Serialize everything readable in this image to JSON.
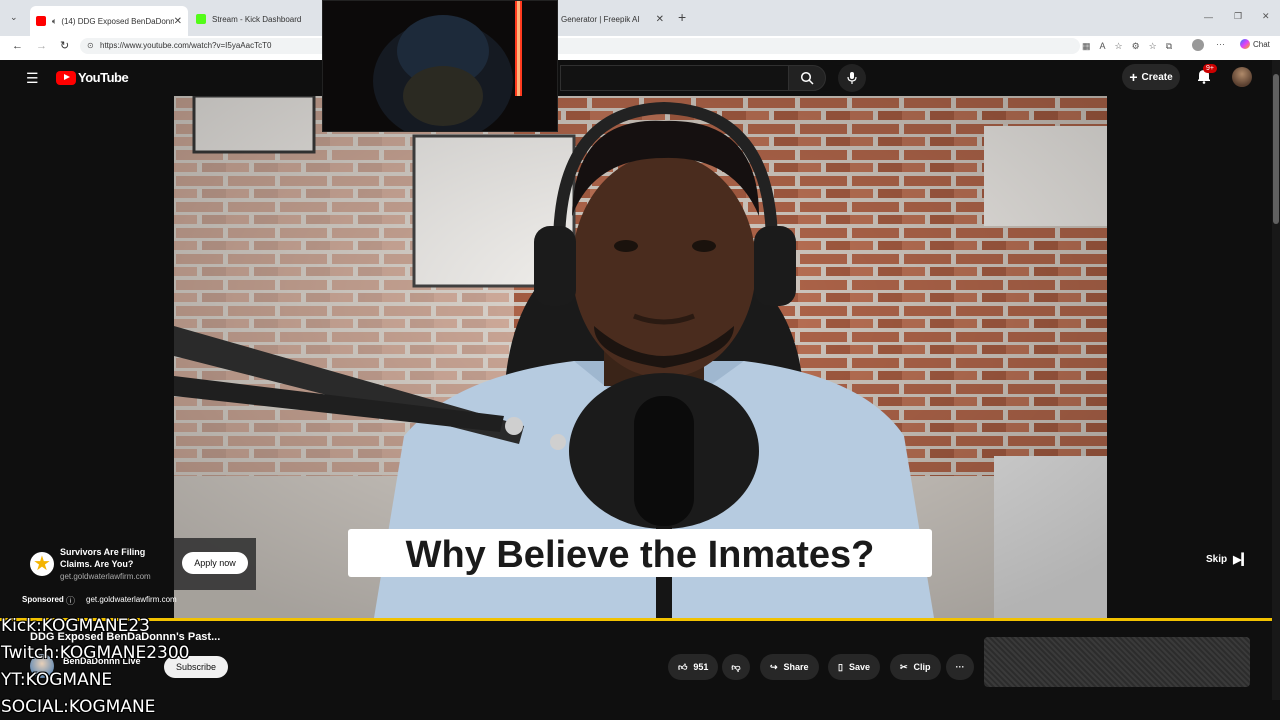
{
  "browser": {
    "tabs": [
      {
        "label": "(14) DDG Exposed BenDaDonn",
        "active": true
      },
      {
        "label": "Stream - Kick Dashboard",
        "active": false
      },
      {
        "label": "Generator | Freepik AI",
        "active": false
      }
    ],
    "new_tab": "+",
    "url": "https://www.youtube.com/watch?v=I5yaAacTcT0",
    "chat_label": "Chat"
  },
  "youtube": {
    "logo_text": "YouTube",
    "create_label": "Create",
    "notification_count": "9+"
  },
  "video": {
    "caption": "Why Believe the Inmates?",
    "skip_label": "Skip"
  },
  "ad": {
    "headline": "Survivors Are Filing Claims. Are You?",
    "domain": "get.goldwaterlawfirm.com",
    "cta": "Apply now",
    "sponsored_label": "Sponsored",
    "sponsored_domain": "get.goldwaterlawfirm.com"
  },
  "watch": {
    "title": "DDG Exposed BenDaDonnn's Past...",
    "channel_name": "BenDaDonnn Live",
    "subscribe_label": "Subscribe",
    "likes": "951",
    "share_label": "Share",
    "save_label": "Save",
    "clip_label": "Clip"
  },
  "stream_overlay": {
    "kick": "Kick:KOGMANE23",
    "twitch": "Twitch:KOGMANE2300",
    "yt": "YT:KOGMANE",
    "social": "SOCIAL:KOGMANE"
  },
  "colors": {
    "yt_red": "#ff0000",
    "progress": "#f2c200",
    "kick_green": "#53fc18"
  }
}
